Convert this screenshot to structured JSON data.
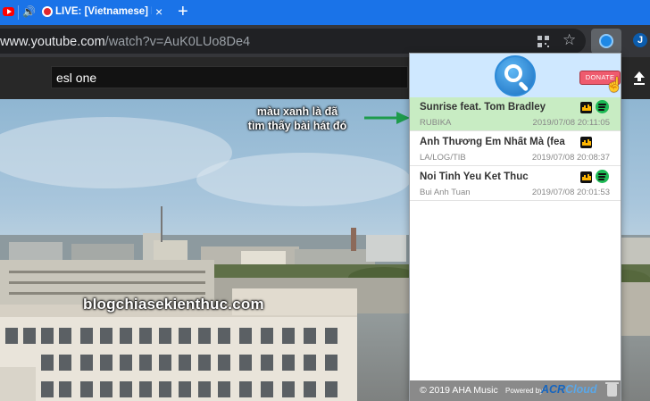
{
  "browser": {
    "tab": {
      "title": "LIVE: [Vietnamese] ESL O",
      "close_glyph": "×"
    },
    "new_tab_glyph": "+",
    "url": {
      "host": "www.youtube.com",
      "path": "/watch?v=AuK0LUo8De4"
    },
    "icons": {
      "star": "☆",
      "speaker": "🔊",
      "profile_letter": "J"
    }
  },
  "youtube": {
    "search_value": "esl one"
  },
  "video": {
    "watermark": "blogchiasekienthuc.com",
    "annotation_line1": "màu xanh là đã",
    "annotation_line2": "tìm thấy bài hát đó",
    "annotation_color": "#1e9b4c"
  },
  "popup": {
    "donate_label": "DONATE",
    "hand_glyph": "☝",
    "songs": [
      {
        "title": "Sunrise feat. Tom Bradley",
        "artist": "RUBIKA",
        "time": "2019/07/08 20:11:05",
        "found": true,
        "deezer": true,
        "spotify": true
      },
      {
        "title": "Anh Thương Em Nhất Mà (fea",
        "artist": "LA/LOG/TIB",
        "time": "2019/07/08 20:08:37",
        "found": false,
        "deezer": true,
        "spotify": false
      },
      {
        "title": "Noi Tinh Yeu Ket Thuc",
        "artist": "Bui Anh Tuan",
        "time": "2019/07/08 20:01:53",
        "found": false,
        "deezer": true,
        "spotify": true
      }
    ],
    "footer": {
      "copyright": "© 2019 AHA Music",
      "powered_by": "Powered by",
      "acr_prefix": "ACR",
      "acr_suffix": "Cloud"
    }
  },
  "colors": {
    "found_row": "#c8ecc3",
    "spotify": "#1db954",
    "donate": "#ef5b6e",
    "tabstrip": "#1a73e8"
  }
}
